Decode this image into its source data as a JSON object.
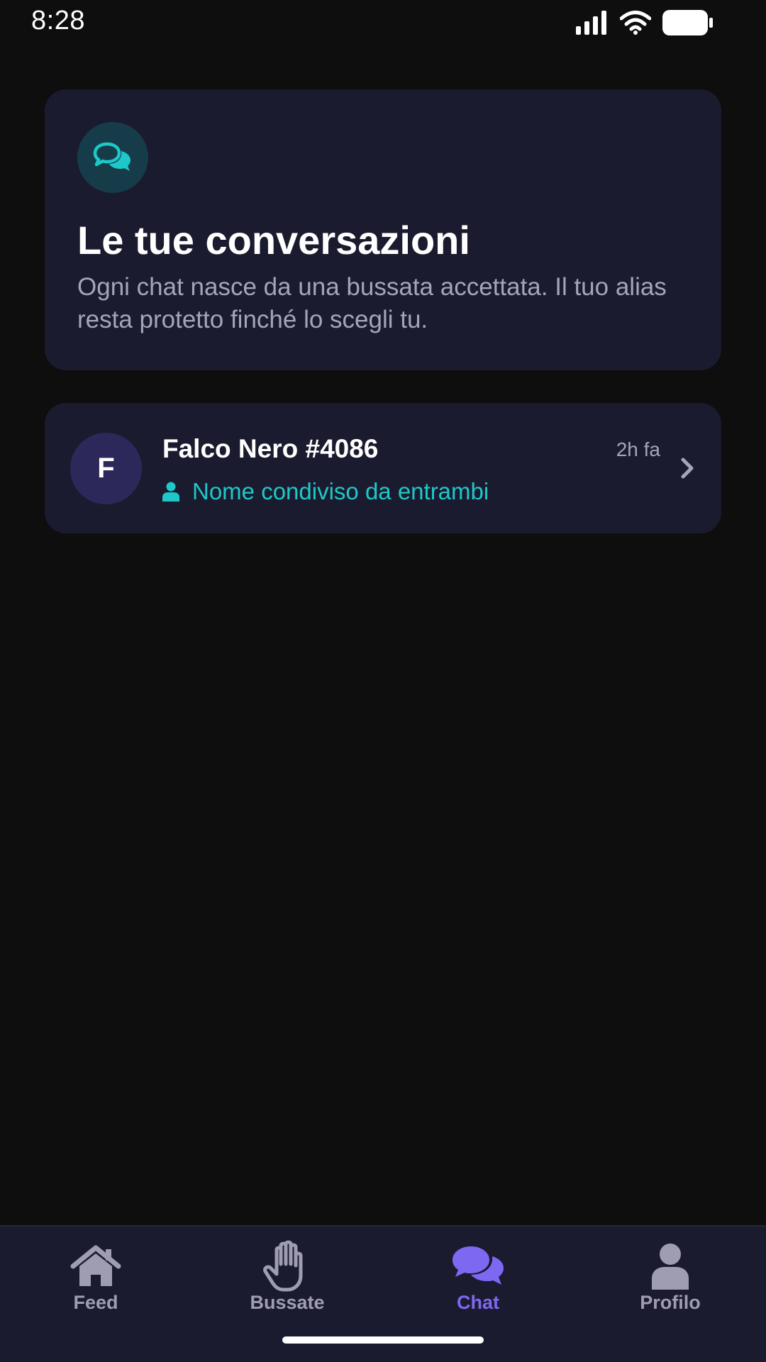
{
  "status_bar": {
    "time": "8:28"
  },
  "header": {
    "icon": "chat-bubbles-icon",
    "title": "Le tue conversazioni",
    "subtitle": "Ogni chat nasce da una bussata accettata. Il tuo alias resta protetto finché lo scegli tu."
  },
  "conversations": [
    {
      "avatar_letter": "F",
      "name": "Falco Nero #4086",
      "time": "2h fa",
      "status_icon": "person-icon",
      "status_text": "Nome condiviso da entrambi"
    }
  ],
  "bottom_nav": {
    "items": [
      {
        "label": "Feed",
        "icon": "home-icon",
        "active": false
      },
      {
        "label": "Bussate",
        "icon": "hand-icon",
        "active": false
      },
      {
        "label": "Chat",
        "icon": "chat-icon",
        "active": true
      },
      {
        "label": "Profilo",
        "icon": "profile-icon",
        "active": false
      }
    ]
  },
  "colors": {
    "background": "#0e0e0f",
    "card": "#1b1b2f",
    "accent_teal": "#1ec8c8",
    "accent_purple": "#7d68f2",
    "muted_text": "#a5a5b7"
  }
}
